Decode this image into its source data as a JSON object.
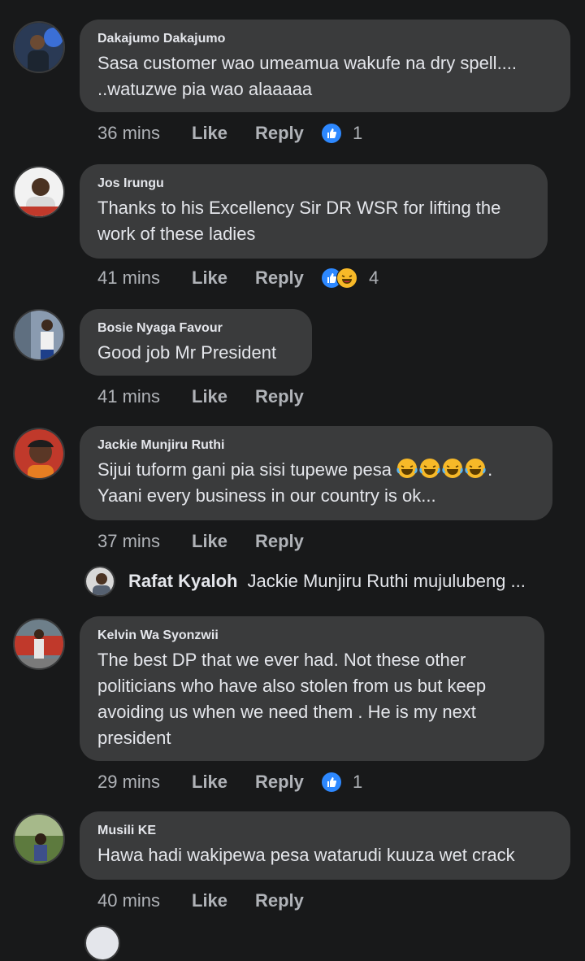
{
  "comments": [
    {
      "name": "Dakajumo Dakajumo",
      "text": "Sasa customer wao umeamua wakufe na dry spell.... ..watuzwe pia wao alaaaaa",
      "time": "36 mins",
      "like": "Like",
      "reply": "Reply",
      "reaction_count": "1",
      "reactions": [
        "like"
      ]
    },
    {
      "name": "Jos Irungu",
      "text": "Thanks to his Excellency Sir DR WSR for lifting the work of these ladies",
      "time": "41 mins",
      "like": "Like",
      "reply": "Reply",
      "reaction_count": "4",
      "reactions": [
        "like",
        "haha"
      ]
    },
    {
      "name": "Bosie Nyaga Favour",
      "text": "Good job Mr President",
      "time": "41 mins",
      "like": "Like",
      "reply": "Reply"
    },
    {
      "name": "Jackie Munjiru Ruthi",
      "text_line1": "Sijui tuform gani pia sisi tupewe pesa",
      "text_line1_end": ".",
      "text_line2": "Yaani every business in our country is ok...",
      "time": "37 mins",
      "like": "Like",
      "reply": "Reply"
    },
    {
      "name": "Kelvin Wa Syonzwii",
      "text": "The best DP that we ever had. Not these other politicians who have also stolen from us but keep avoiding us when we need them . He is my next president",
      "time": "29 mins",
      "like": "Like",
      "reply": "Reply",
      "reaction_count": "1",
      "reactions": [
        "like"
      ]
    },
    {
      "name": "Musili KE",
      "text": "Hawa hadi wakipewa pesa watarudi kuuza wet crack",
      "time": "40 mins",
      "like": "Like",
      "reply": "Reply"
    }
  ],
  "reply_preview": {
    "name": "Rafat Kyaloh",
    "text": "Jackie Munjiru Ruthi mujulubeng ..."
  },
  "colors": {
    "background": "#18191a",
    "bubble": "#3a3b3c",
    "like_blue": "#2d88ff",
    "haha_yellow": "#f7b928"
  }
}
